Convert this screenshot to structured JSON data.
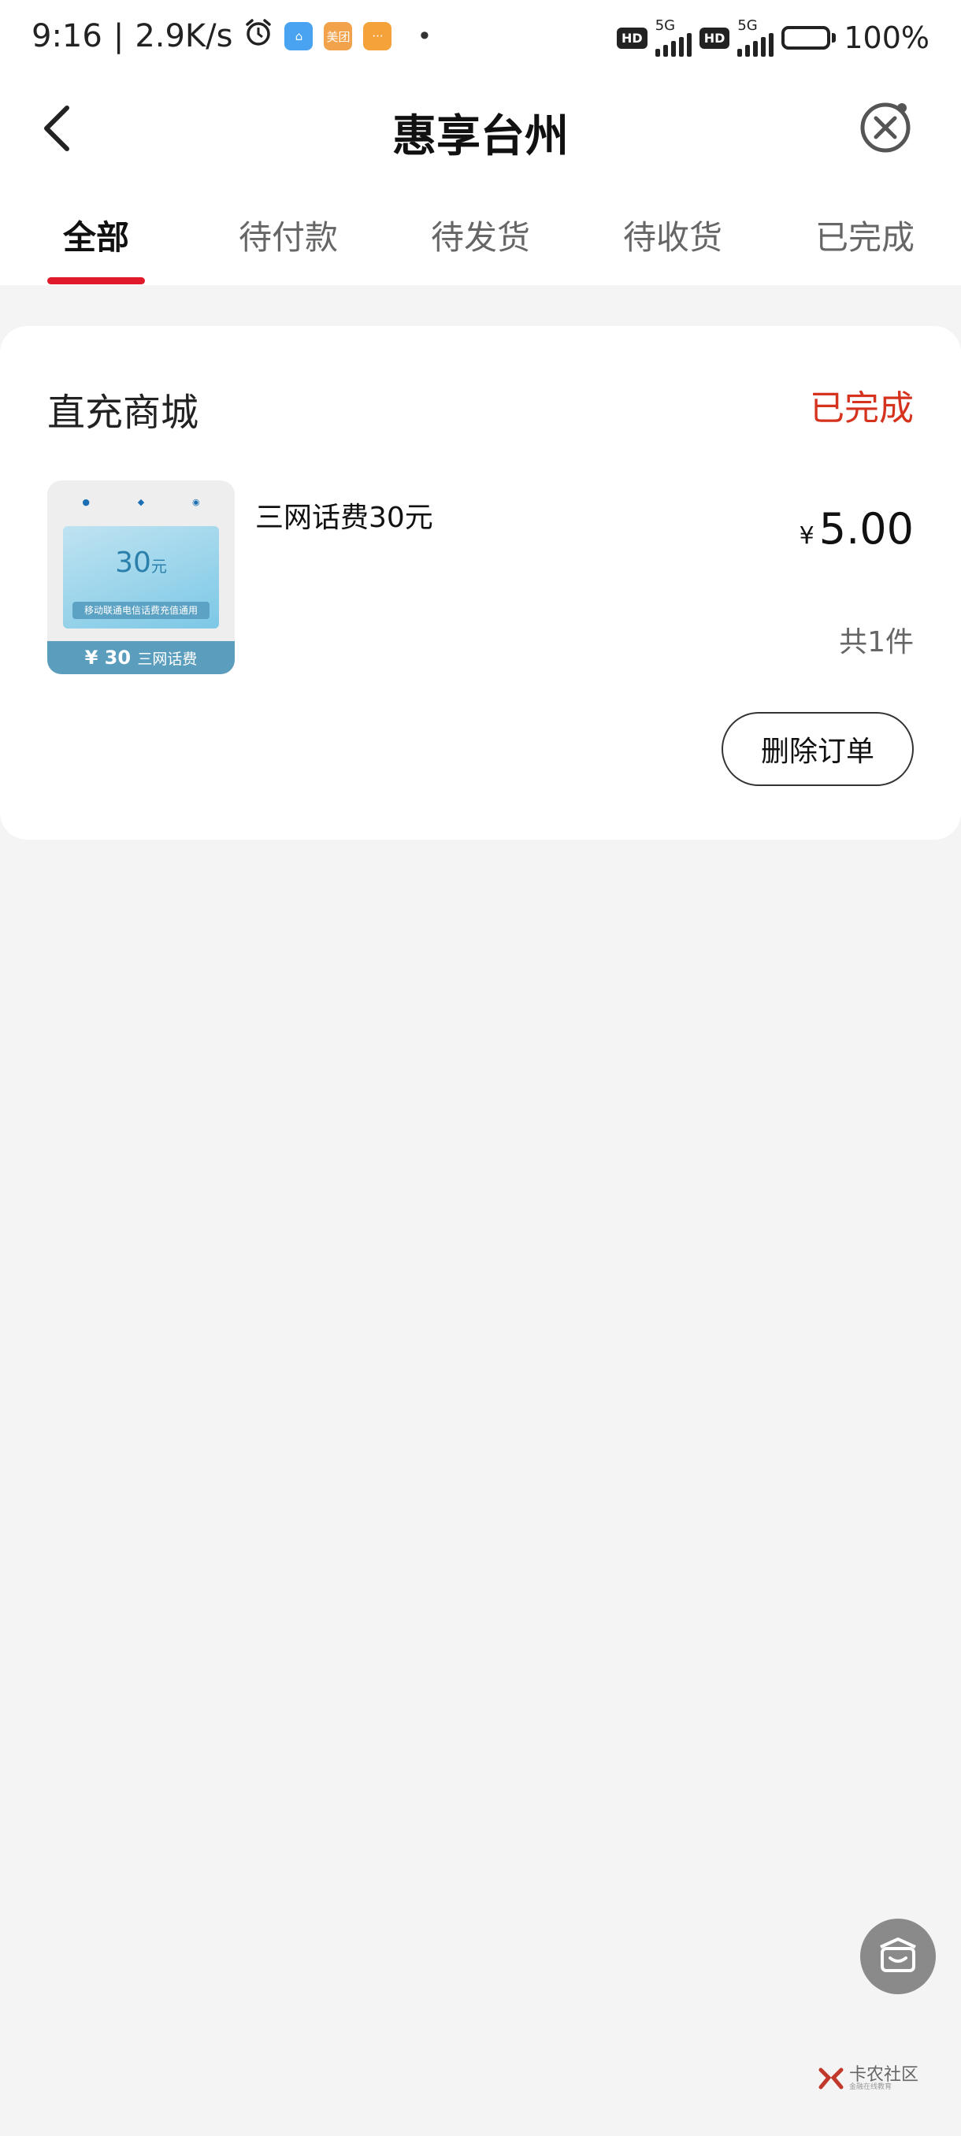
{
  "status_bar": {
    "time": "9:16",
    "network_speed": "2.9K/s",
    "app_icons": [
      "home-app-icon",
      "meituan-app-icon",
      "message-app-icon"
    ],
    "meituan_label": "美团",
    "sim1": {
      "hd": "HD",
      "network": "5G"
    },
    "sim2": {
      "hd": "HD",
      "network": "5G"
    },
    "battery": "100%",
    "battery_level": 1.0
  },
  "nav": {
    "title": "惠享台州",
    "back_icon": "chevron-left-icon",
    "close_icon": "close-circle-icon"
  },
  "tabs": [
    {
      "label": "全部",
      "active": true
    },
    {
      "label": "待付款",
      "active": false
    },
    {
      "label": "待发货",
      "active": false
    },
    {
      "label": "待收货",
      "active": false
    },
    {
      "label": "已完成",
      "active": false
    }
  ],
  "order": {
    "shop_name": "直充商城",
    "status": "已完成",
    "product": {
      "name": "三网话费30元",
      "thumbnail": {
        "amount": "30",
        "amount_unit": "元",
        "caption": "移动联通电信话费充值通用",
        "band_amount": "¥ 30",
        "band_label": "三网话费"
      }
    },
    "currency_symbol": "¥",
    "price": "5.00",
    "quantity_text": "共1件",
    "delete_button": "删除订单"
  },
  "floating_button": {
    "icon": "home-box-icon"
  },
  "watermark": {
    "text": "卡农社区",
    "subtext": "金融在线教育"
  },
  "colors": {
    "accent_red": "#e0192b",
    "status_red": "#d6331f",
    "page_bg": "#f4f4f4"
  }
}
